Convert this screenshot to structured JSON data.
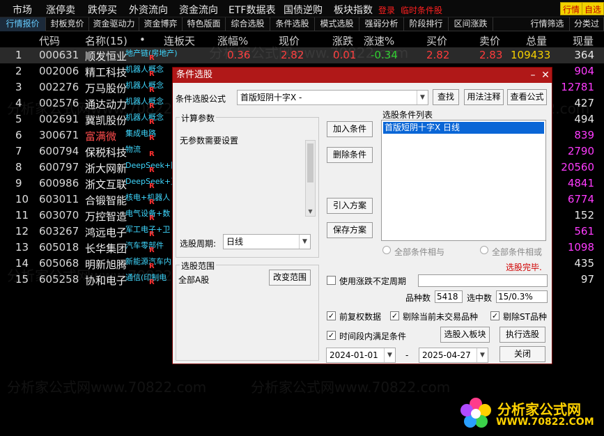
{
  "menu": {
    "items": [
      "市场",
      "涨停卖",
      "跌停买",
      "外资流向",
      "资金流向",
      "ETF数据表",
      "国债逆购",
      "板块指数"
    ],
    "login": "登录",
    "temp_condition": "临时条件股",
    "btn_quote": "行情",
    "btn_stock": "自选"
  },
  "tabs": [
    "行情报价",
    "封板竞价",
    "资金驱动力",
    "资金博弈",
    "特色版面",
    "综合选股",
    "条件选股",
    "模式选股",
    "强弱分析",
    "阶段排行",
    "区间涨跌",
    "行情筛选",
    "分类过"
  ],
  "table": {
    "headers": [
      "代码",
      "名称(15)",
      "•",
      "连板天",
      "涨幅%",
      "现价",
      "涨跌",
      "涨速%",
      "买价",
      "卖价",
      "总量",
      "现量"
    ],
    "rows": [
      {
        "idx": "1",
        "code": "000631",
        "name": "顺发恒业",
        "tag": "地产链(房地产)",
        "r": "R",
        "pct": "0.36",
        "price": "2.82",
        "chg": "0.01",
        "speed": "-0.34",
        "bid": "2.82",
        "ask": "2.83",
        "vol": "109433",
        "cur": "364"
      },
      {
        "idx": "2",
        "code": "002006",
        "name": "精工科技",
        "tag": "机器人概念",
        "r": "R",
        "cur": "904"
      },
      {
        "idx": "3",
        "code": "002276",
        "name": "万马股份",
        "tag": "机器人概念",
        "r": "R",
        "cur": "12781"
      },
      {
        "idx": "4",
        "code": "002576",
        "name": "通达动力",
        "tag": "机器人概念",
        "r": "R",
        "cur": "427"
      },
      {
        "idx": "5",
        "code": "002691",
        "name": "冀凯股份",
        "tag": "机器人概念",
        "r": "R",
        "cur": "494"
      },
      {
        "idx": "6",
        "code": "300671",
        "name": "富满微",
        "tag": "集成电路",
        "r": "R",
        "cur": "839"
      },
      {
        "idx": "7",
        "code": "600794",
        "name": "保税科技",
        "tag": "物流",
        "r": "R",
        "cur": "2790"
      },
      {
        "idx": "8",
        "code": "600797",
        "name": "浙大网新",
        "tag": "DeepSeek+阿",
        "r": "R",
        "cur": "20560"
      },
      {
        "idx": "9",
        "code": "600986",
        "name": "浙文互联",
        "tag": "DeepSeek+互",
        "r": "R",
        "cur": "4841"
      },
      {
        "idx": "10",
        "code": "603011",
        "name": "合锻智能",
        "tag": "核电+机器人",
        "r": "R",
        "cur": "6774"
      },
      {
        "idx": "11",
        "code": "603070",
        "name": "万控智造",
        "tag": "电气设备+数",
        "r": "R",
        "cur": "152"
      },
      {
        "idx": "12",
        "code": "603267",
        "name": "鸿远电子",
        "tag": "军工电子+卫",
        "r": "R",
        "cur": "561"
      },
      {
        "idx": "13",
        "code": "605018",
        "name": "长华集团",
        "tag": "汽车零部件",
        "r": "R",
        "cur": "1098"
      },
      {
        "idx": "14",
        "code": "605068",
        "name": "明新旭腾",
        "tag": "新能源汽车内",
        "r": "R",
        "cur": "435"
      },
      {
        "idx": "15",
        "code": "605258",
        "name": "协和电子",
        "tag": "通信(印制电",
        "r": "R",
        "cur": "97"
      }
    ]
  },
  "watermark": "分析家公式网www.70822.com",
  "dialog": {
    "title": "条件选股",
    "formula_label": "条件选股公式",
    "formula_value": "首版短阴十字X  -",
    "btn_find": "查找",
    "btn_usage": "用法注释",
    "btn_view": "查看公式",
    "calc_params": "计算参数",
    "no_params": "无参数需要设置",
    "btn_add": "加入条件",
    "btn_delete": "删除条件",
    "btn_import": "引入方案",
    "btn_save": "保存方案",
    "list_title": "选股条件列表",
    "list_item": "首版短阴十字X  日线",
    "period_label": "选股周期:",
    "period_value": "日线",
    "radio_and": "全部条件相与",
    "radio_or": "全部条件相或",
    "status": "选股完毕.",
    "scope_title": "选股范围",
    "scope_value": "全部A股",
    "btn_change_scope": "改变范围",
    "chk_uncertain": "使用涨跌不定周期",
    "count_label": "品种数",
    "count_value": "5418",
    "selected_label": "选中数",
    "selected_value": "15/0.3%",
    "chk_prefq": "前复权数据",
    "chk_exclude_notrade": "剔除当前未交易品种",
    "chk_exclude_st": "剔除ST品种",
    "chk_period": "时间段内满足条件",
    "btn_to_block": "选股入板块",
    "btn_exec": "执行选股",
    "date_from": "2024-01-01",
    "date_sep": "-",
    "date_to": "2025-04-27",
    "btn_close": "关闭"
  },
  "logo": {
    "line1": "分析家公式网",
    "line2": "WWW.70822.COM"
  },
  "colors": {
    "rise": "#ff3b3b",
    "fall": "#2ecc2e",
    "title_bar": "#b01818",
    "accent": "#f5d000"
  }
}
